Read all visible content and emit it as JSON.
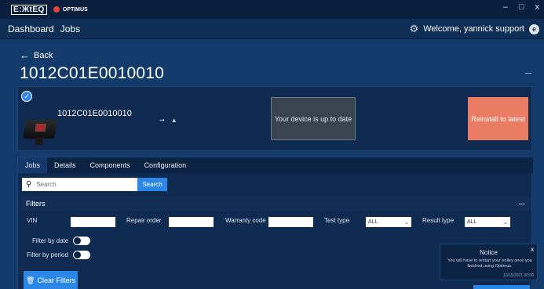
{
  "titlebar": {
    "brand_a": "E:ЖtEQ",
    "brand_b": "OPTIMUS",
    "minimize": "–",
    "maximize": "□",
    "close": "x"
  },
  "nav": {
    "dashboard": "Dashboard",
    "jobs": "Jobs",
    "welcome": "Welcome, yannick support",
    "user_initial": "e"
  },
  "page": {
    "back": "Back",
    "title": "1012C01E0010010"
  },
  "device": {
    "id": "1012C01E0010010",
    "status": "Your device is up to date",
    "reinstall": "Reinstall to latest"
  },
  "tabs": [
    "Jobs",
    "Details",
    "Components",
    "Configuration"
  ],
  "search": {
    "placeholder": "Search",
    "button": "Search"
  },
  "filters": {
    "heading": "Filters",
    "vin": "VIN",
    "repair_order": "Repair order",
    "warranty_code": "Warranty code",
    "test_type": "Test type",
    "test_type_value": "ALL",
    "result_type": "Result type",
    "result_type_value": "ALL",
    "by_date": "Filter by date",
    "by_period": "Filter by period",
    "clear": "Clear Filters"
  },
  "notice": {
    "title": "Notice",
    "close": "x",
    "body": "You will have to restart your trolley once you finished using Optimus.",
    "time": "10/15/2021 00:00"
  },
  "colors": {
    "accent": "#2b87e6",
    "reinstall": "#e97c62",
    "bg": "#123a6b"
  }
}
